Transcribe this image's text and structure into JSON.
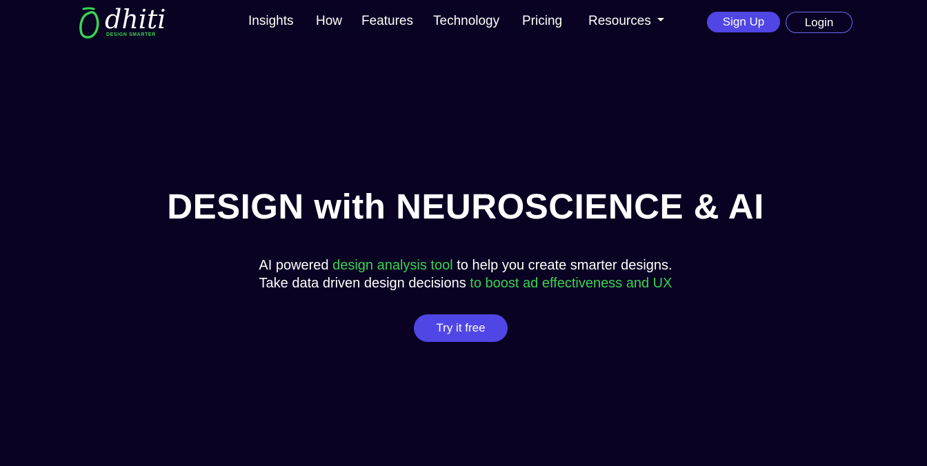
{
  "brand": {
    "name": "dhiti",
    "tagline": "DESIGN SMARTER",
    "accent_color": "#39d353",
    "logo_icon": "leaf-drop-icon"
  },
  "nav": {
    "items": [
      {
        "label": "Insights"
      },
      {
        "label": "How"
      },
      {
        "label": "Features"
      },
      {
        "label": "Technology"
      },
      {
        "label": "Pricing"
      },
      {
        "label": "Resources",
        "icon": "caret-down-icon"
      }
    ],
    "signup_label": "Sign Up",
    "login_label": "Login"
  },
  "hero": {
    "title": "DESIGN with NEUROSCIENCE & AI",
    "line1": {
      "before": "AI powered ",
      "highlight": "design analysis tool",
      "after": " to help you create smarter designs."
    },
    "line2": {
      "before": "Take data driven design decisions ",
      "highlight": "to boost ad effectiveness and UX"
    },
    "cta_label": "Try it free"
  },
  "colors": {
    "background": "#0a0222",
    "primary_button": "#5046e5",
    "login_border": "#6e6cf5",
    "highlight_text": "#39d353"
  }
}
